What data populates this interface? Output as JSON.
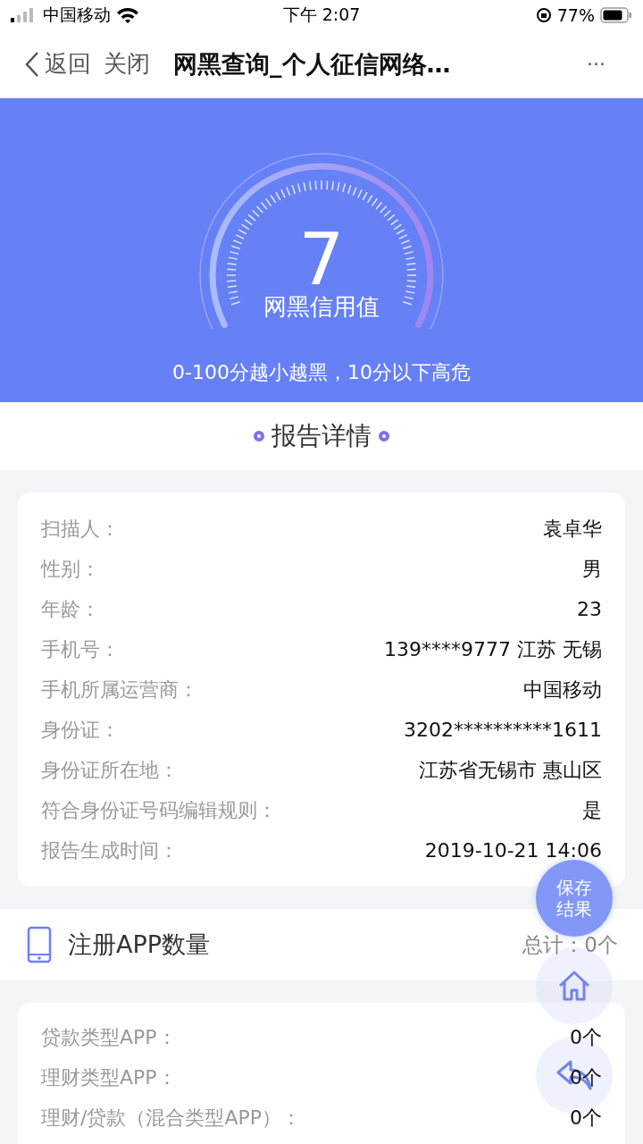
{
  "status_bar": {
    "carrier": "中国移动",
    "time": "下午 2:07",
    "battery": "77%"
  },
  "nav": {
    "back": "返回",
    "close": "关闭",
    "title": "网黑查询_个人征信网络…",
    "more": "···"
  },
  "score": {
    "value": "7",
    "label": "网黑信用值",
    "hint": "0-100分越小越黑，10分以下高危"
  },
  "report_title": "报告详情",
  "details": [
    {
      "label": "扫描人：",
      "value": "袁卓华"
    },
    {
      "label": "性别：",
      "value": "男"
    },
    {
      "label": "年龄：",
      "value": "23"
    },
    {
      "label": "手机号：",
      "value": "139****9777 江苏 无锡"
    },
    {
      "label": "手机所属运营商：",
      "value": "中国移动"
    },
    {
      "label": "身份证：",
      "value": "3202**********1611"
    },
    {
      "label": "身份证所在地：",
      "value": "江苏省无锡市 惠山区"
    },
    {
      "label": "符合身份证号码编辑规则：",
      "value": "是"
    },
    {
      "label": "报告生成时间：",
      "value": "2019-10-21 14:06"
    }
  ],
  "apps_section": {
    "title": "注册APP数量",
    "total": "总计：0个"
  },
  "apps": [
    {
      "label": "贷款类型APP：",
      "value": "0个"
    },
    {
      "label": "理财类型APP：",
      "value": "0个"
    },
    {
      "label": "理财/贷款（混合类型APP）：",
      "value": "0个"
    }
  ],
  "fab": {
    "save": [
      "保存",
      "结果"
    ]
  }
}
